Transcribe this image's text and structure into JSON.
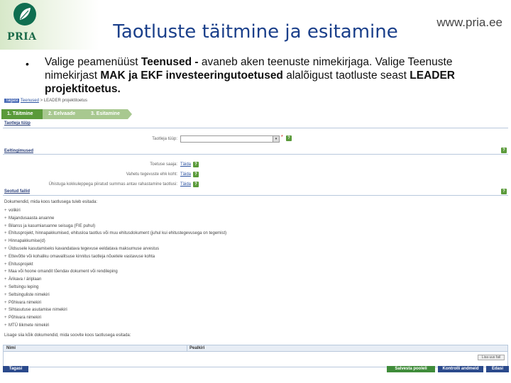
{
  "slide": {
    "logo_text": "PRIA",
    "title": "Taotluste täitmine ja esitamine",
    "url": "www.pria.ee",
    "bullet": {
      "mark": "•",
      "t1": "Valige peamenüüst ",
      "b1": "Teenused - ",
      "t2": "avaneb aken teenuste nimekirjaga. Valige Teenuste nimekirjast ",
      "b2": "MAK ja EKF investeeringutoetused",
      "t3": " alalõigust taotluste seast ",
      "b3": "LEADER projektitoetus."
    }
  },
  "app": {
    "breadcrumb": {
      "home": "Tagasi",
      "link": "Teenused",
      "sep": " > ",
      "current": "LEADER projektitoetus"
    },
    "steps": [
      "1. Täitmine",
      "2. Eelvaade",
      "3. Esitamine"
    ],
    "sections": {
      "applicant_type": "Taotleja tüüp",
      "prerequisites": "Eeltingimused",
      "related_files": "Seotud failid"
    },
    "applicant_label": "Taotleja tüüp:",
    "required_mark": "*",
    "help_mark": "?",
    "select_arrow": "▾",
    "prereq_rows": [
      {
        "label": "Toetuse saaja:",
        "link": "Täida"
      },
      {
        "label": "Vahetu tegevuste ehk koht:",
        "link": "Täida"
      },
      {
        "label": "Ühistuga kokkuleppega piiratud summas antav rahastamine taotlusi:",
        "link": "Täida"
      }
    ],
    "docs_intro": "Dokumendid, mida koos taotlusega tuleb esitada:",
    "plus": "+",
    "documents": [
      "volikiri",
      "Majandusaasta aruanne",
      "Bilanss ja kasumiaruanne seisuga (FIE puhul)",
      "Ehitusprojekt, hinnapakkumised, ehitusloa taotlus või muu ehitusdokument (juhul kui ehitustegevusega on tegemist)",
      "Hinnapakkumise(d)",
      "Üldsusele kasutamiseks kavandatava tegevuse eeldatava maksumuse arvestus",
      "Ettevõtte või kohaliku omavalitsuse kinnitus taotleja nõuetele vastavuse kohta",
      "Ehitusprojekt",
      "Maa või hoone omandit tõendav dokument või rendileping",
      "Ärikava / äriplaan",
      "Seltsingu leping",
      "Seltsinguliste nimekiri",
      "Põhivara nimekiri",
      "Sihtasutuse asutamise nimekiri",
      "Põhivara nimekiri",
      "MTÜ liikmete nimekiri"
    ],
    "extra_intro": "Lisage siia kõik dokumendid, mida soovite koos taotlusega esitada:",
    "grid_headers": [
      "Nimi",
      "Pealkiri"
    ],
    "upload_label": "Lisa uus fail",
    "buttons": {
      "back": "Tagasi",
      "save": "Salvesta pooleli",
      "check": "Kontrolli andmeid",
      "next": "Edasi"
    }
  }
}
